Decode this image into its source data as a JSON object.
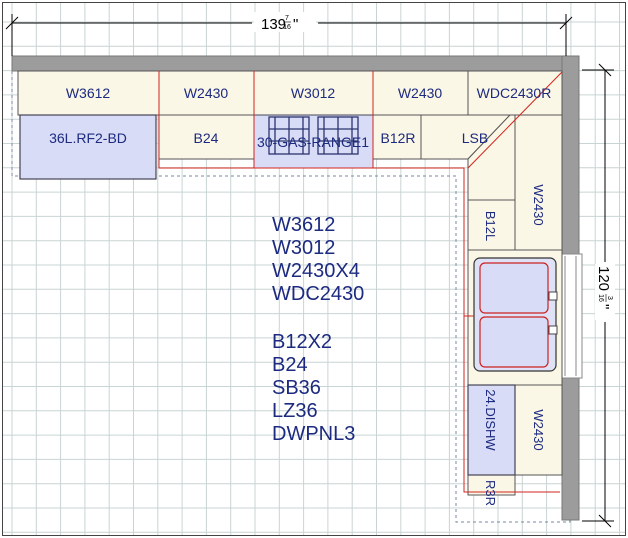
{
  "dimensions": {
    "width_whole": "139",
    "width_num": "7",
    "width_den": "16",
    "height_whole": "120",
    "height_num": "3",
    "height_den": "16",
    "inch_mark": "\""
  },
  "upper_cabinets": {
    "w3612": "W3612",
    "w2430_a": "W2430",
    "w3012": "W3012",
    "w2430_b": "W2430",
    "wdc2430r": "WDC2430R",
    "w2430_right": "W2430",
    "w2430_right_lower": "W2430"
  },
  "base_cabinets": {
    "fridge": "36L.RF2-BD",
    "b24": "B24",
    "range": "30-GAS-RANGE1",
    "b12r": "B12R",
    "lsb": "LSB",
    "b12l": "B12L",
    "dishwasher": "24.DISHW",
    "b3r": "R3R"
  },
  "summary_list": {
    "uppers": [
      "W3612",
      "W3012",
      "W2430X4",
      "WDC2430"
    ],
    "bases": [
      "B12X2",
      "B24",
      "SB36",
      "LZ36",
      "DWPNL3"
    ]
  },
  "colors": {
    "cabinet": "#fbf7e6",
    "appliance": "#d9dcf6",
    "wall": "#9c9c9c",
    "grid": "#c9d4d4",
    "highlight": "#d2261f",
    "label": "#1c2a80"
  }
}
